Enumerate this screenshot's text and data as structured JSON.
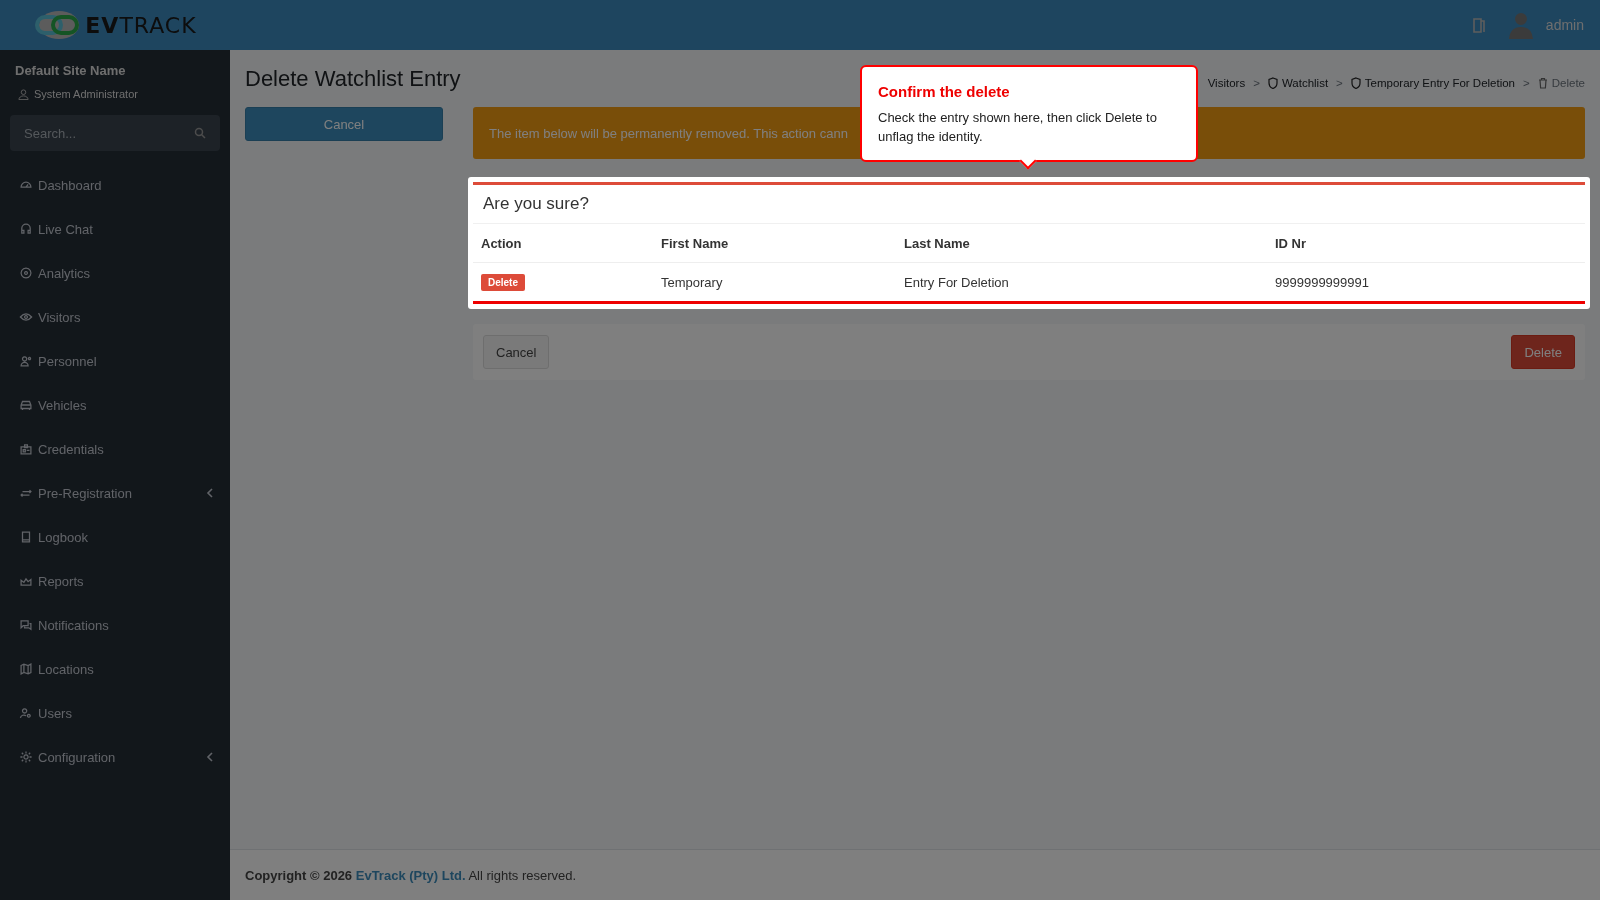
{
  "header": {
    "logo": "**EV**TRACK",
    "user": "admin"
  },
  "sidebar": {
    "site_name": "Default Site Name",
    "role": "System Administrator",
    "search": {
      "placeholder": "Search..."
    },
    "items": [
      {
        "label": "Dashboard",
        "has_submenu": false
      },
      {
        "label": "Live Chat",
        "has_submenu": false
      },
      {
        "label": "Analytics",
        "has_submenu": false
      },
      {
        "label": "Visitors",
        "has_submenu": false
      },
      {
        "label": "Personnel",
        "has_submenu": false
      },
      {
        "label": "Vehicles",
        "has_submenu": false
      },
      {
        "label": "Credentials",
        "has_submenu": false
      },
      {
        "label": "Pre-Registration",
        "has_submenu": true
      },
      {
        "label": "Logbook",
        "has_submenu": false
      },
      {
        "label": "Reports",
        "has_submenu": false
      },
      {
        "label": "Notifications",
        "has_submenu": false
      },
      {
        "label": "Locations",
        "has_submenu": false
      },
      {
        "label": "Users",
        "has_submenu": false
      },
      {
        "label": "Configuration",
        "has_submenu": true
      }
    ]
  },
  "page": {
    "title": "Delete Watchlist Entry",
    "cancel_button": "Cancel",
    "breadcrumb": [
      {
        "label": "Visitors",
        "icon": false,
        "separator": ">"
      },
      {
        "label": "Watchlist",
        "icon": true,
        "separator": ">"
      },
      {
        "label": "Temporary Entry For Deletion",
        "icon": true,
        "separator": ">"
      },
      {
        "label": "Delete",
        "icon": true
      }
    ],
    "alert": "The item below will be permanently removed. This action cann",
    "card": {
      "title": "Are you sure?",
      "columns": [
        "Action",
        "First Name",
        "Last Name",
        "ID Nr"
      ],
      "rows": [
        {
          "action": "Delete",
          "first_name": "Temporary",
          "last_name": "Entry For Deletion",
          "id_nr": "9999999999991"
        }
      ]
    },
    "actions": {
      "cancel": "Cancel",
      "delete": "Delete"
    }
  },
  "tooltip": {
    "title": "Confirm the delete",
    "text": "Check the entry shown here, then click Delete to unflag the identity."
  },
  "footer": {
    "prefix": "Copyright © 2026",
    "link": "EvTrack (Pty) Ltd.",
    "suffix": "All rights reserved."
  }
}
